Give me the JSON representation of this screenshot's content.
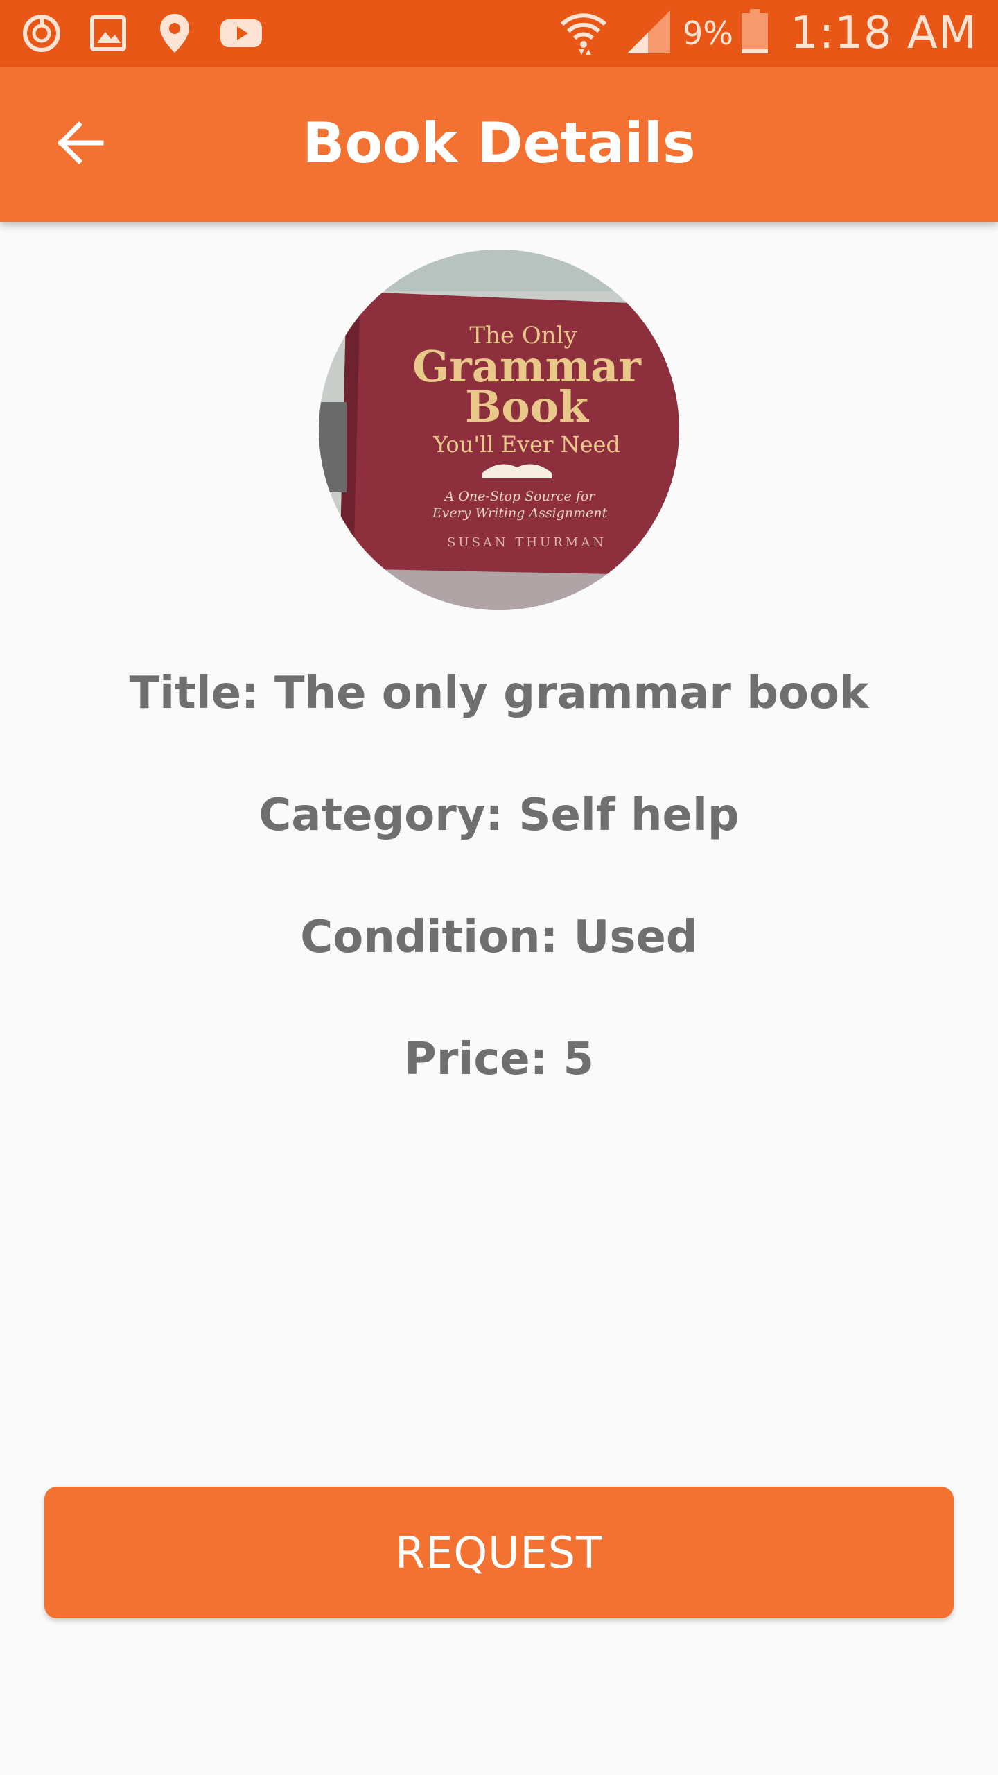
{
  "status_bar": {
    "left_icons": [
      "sync-icon",
      "gallery-icon",
      "location-pin-icon",
      "youtube-icon"
    ],
    "battery_percent": "9%",
    "time": "1:18 AM"
  },
  "app_bar": {
    "title": "Book Details",
    "back_icon": "arrow-back-icon"
  },
  "book": {
    "cover": {
      "line1": "The Only",
      "line2": "Grammar",
      "line3": "Book",
      "line4": "You'll Ever Need",
      "subtitle1": "A One-Stop Source for",
      "subtitle2": "Every Writing Assignment",
      "author": "SUSAN THURMAN"
    },
    "title_label": "Title: ",
    "title": "The only grammar book",
    "category_label": "Category: ",
    "category": "Self help",
    "condition_label": "Condition: ",
    "condition": "Used",
    "price_label": "Price: ",
    "price": "5"
  },
  "actions": {
    "request_label": "REQUEST"
  },
  "colors": {
    "status_bar": "#e95716",
    "accent": "#f37131",
    "text": "#6f6f6f",
    "background": "#fafafa"
  }
}
